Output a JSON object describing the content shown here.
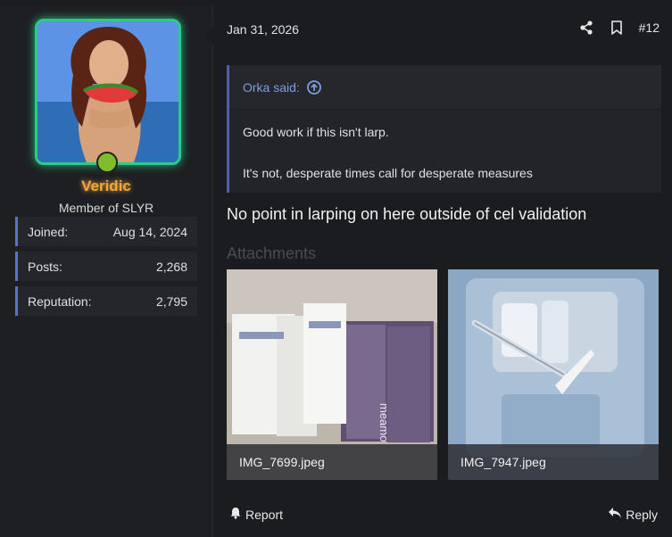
{
  "user": {
    "username": "Veridic",
    "title": "Member of SLYR",
    "stats": [
      {
        "label": "Joined:",
        "value": "Aug 14, 2024"
      },
      {
        "label": "Posts:",
        "value": "2,268"
      },
      {
        "label": "Reputation:",
        "value": "2,795"
      }
    ],
    "colors": {
      "username": "#f3a63a",
      "avatar_border": "#2ec98a",
      "online": "#7fbe2a"
    }
  },
  "post": {
    "date": "Jan 31, 2026",
    "number": "#12",
    "quote": {
      "author": "Orka said:",
      "lines": [
        "Good work if this isn't larp.",
        "It's not, desperate times call for desperate measures"
      ]
    },
    "text": "No point in larping on here outside of cel validation",
    "attachments_label": "Attachments",
    "attachments": [
      {
        "filename": "IMG_7699.jpeg"
      },
      {
        "filename": "IMG_7947.jpeg"
      }
    ],
    "footer": {
      "report": "Report",
      "reply": "Reply"
    }
  },
  "icons": [
    "share-icon",
    "bookmark-icon",
    "arrow-up-circle-icon",
    "bell-icon",
    "reply-icon"
  ]
}
